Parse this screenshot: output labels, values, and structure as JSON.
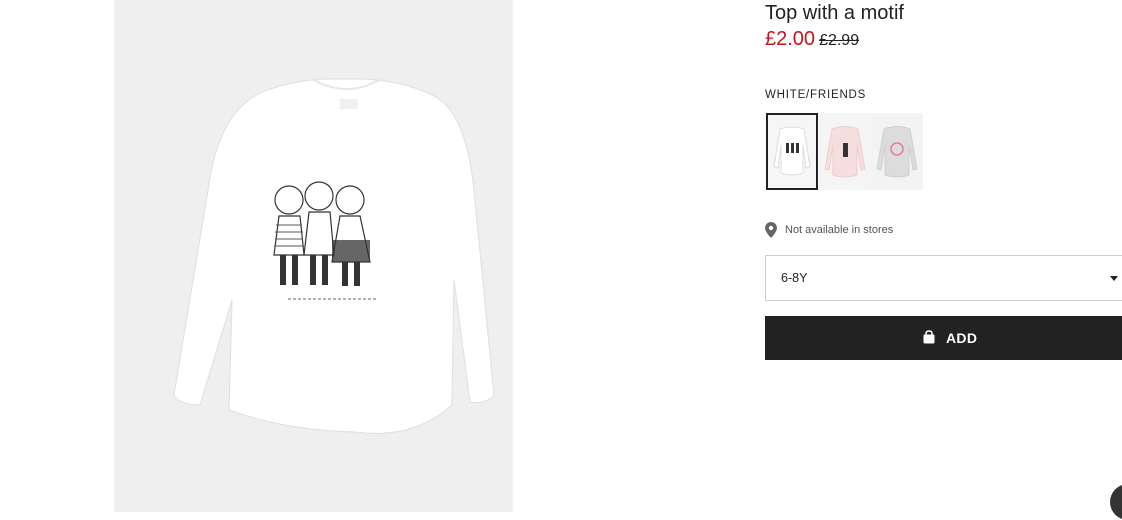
{
  "product": {
    "title": "Top with a motif",
    "price_sale": "£2.00",
    "price_original": "£2.99",
    "color_name": "WHITE/FRIENDS",
    "swatches": [
      {
        "name": "white-friends",
        "selected": true
      },
      {
        "name": "light-pink",
        "selected": false
      },
      {
        "name": "light-grey",
        "selected": false
      }
    ]
  },
  "availability": {
    "text": "Not available in stores"
  },
  "size_select": {
    "value": "6-8Y"
  },
  "add_button": {
    "label": "ADD"
  },
  "icons": [
    "location-pin-icon",
    "shopping-bag-icon",
    "chevron-down-icon"
  ],
  "colors": {
    "sale_price": "#c4161c",
    "button_bg": "#222222",
    "image_bg": "#efefef"
  }
}
